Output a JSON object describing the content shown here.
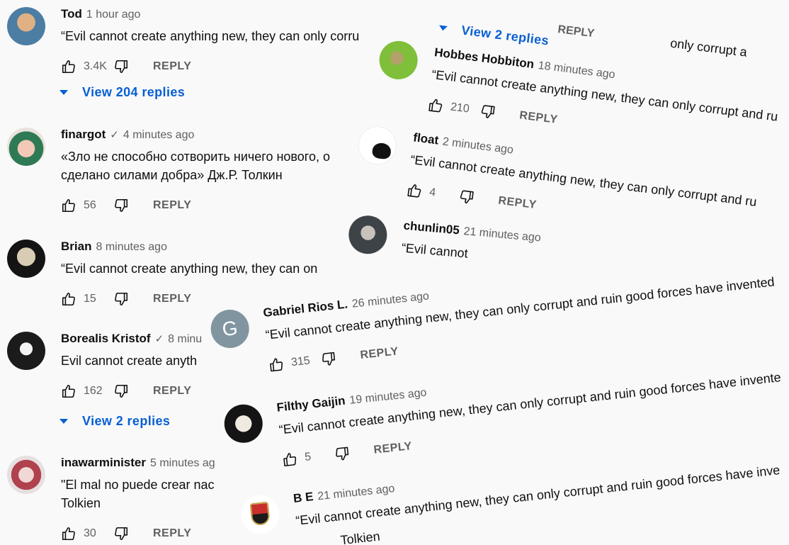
{
  "main": {
    "comments": [
      {
        "author": "Tod",
        "time": "1 hour ago",
        "text": "“Evil cannot create anything new, they can only corru",
        "likes": "3.4K",
        "reply": "REPLY",
        "view_replies": "View 204 replies"
      },
      {
        "author": "finargot",
        "verified": "✓",
        "time": "4 minutes ago",
        "text": "«Зло не способно сотворить ничего нового, о\nсделано силами добра» Дж.Р. Толкин",
        "likes": "56",
        "reply": "REPLY"
      },
      {
        "author": "Brian",
        "time": "8 minutes ago",
        "text": "“Evil cannot create anything new, they can on",
        "likes": "15",
        "reply": "REPLY"
      },
      {
        "author": "Borealis Kristof",
        "verified": "✓",
        "time": "8 minu",
        "text": "Evil cannot create anyth",
        "likes": "162",
        "reply": "REPLY",
        "view_replies": "View 2 replies"
      },
      {
        "author": "inawarminister",
        "time": "5 minutes ag",
        "text": "\"El mal no puede crear nac\nTolkien",
        "likes": "30",
        "reply": "REPLY"
      }
    ]
  },
  "overlays": {
    "top": {
      "reply": "REPLY",
      "view_replies": "View 2 replies",
      "text": "only corrupt a"
    },
    "hobbes": {
      "author": "Hobbes Hobbiton",
      "time": "18 minutes ago",
      "text": "“Evil cannot create anything new, they can only corrupt and ru",
      "likes": "210",
      "reply": "REPLY"
    },
    "float": {
      "author": "float",
      "time": "2 minutes ago",
      "text": "“Evil cannot create anything new, they can only corrupt and ru",
      "likes": "4",
      "reply": "REPLY"
    },
    "chunlin": {
      "author": "chunlin05",
      "time": "21 minutes ago",
      "text": "“Evil cannot"
    },
    "gabriel": {
      "author": "Gabriel Rios L.",
      "time": "26 minutes ago",
      "initial": "G",
      "text": "“Evil cannot create anything new, they can only corrupt and ruin good forces have invented",
      "likes": "315",
      "reply": "REPLY"
    },
    "filthy": {
      "author": "Filthy Gaijin",
      "time": "19 minutes ago",
      "text": "“Evil cannot create anything new, they can only corrupt and ruin good forces have invente",
      "likes": "5",
      "reply": "REPLY"
    },
    "be": {
      "author": "B E",
      "time": "21 minutes ago",
      "text": "“Evil cannot create anything new, they can only corrupt and ruin good forces have inve",
      "tail": "Tolkien"
    }
  }
}
